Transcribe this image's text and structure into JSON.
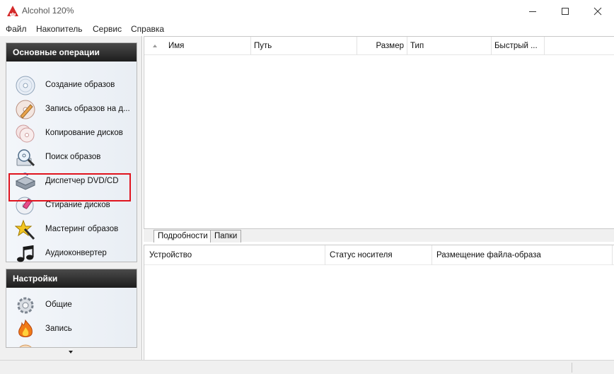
{
  "window": {
    "title": "Alcohol 120%",
    "minimize_icon": "minimize-icon",
    "maximize_icon": "maximize-icon",
    "close_icon": "close-icon"
  },
  "menu": [
    "Файл",
    "Накопитель",
    "Сервис",
    "Справка"
  ],
  "sidebar": {
    "main_group": {
      "title": "Основные операции",
      "items": [
        {
          "label": "Создание образов",
          "icon": "disc-create-icon"
        },
        {
          "label": "Запись образов на д...",
          "icon": "disc-burn-icon"
        },
        {
          "label": "Копирование дисков",
          "icon": "disc-copy-icon"
        },
        {
          "label": "Поиск образов",
          "icon": "image-search-icon"
        },
        {
          "label": "Диспетчер DVD/CD",
          "icon": "drive-manager-icon"
        },
        {
          "label": "Стирание дисков",
          "icon": "disc-erase-icon"
        },
        {
          "label": "Мастеринг образов",
          "icon": "mastering-star-icon"
        },
        {
          "label": "Аудиоконвертер",
          "icon": "audio-notes-icon"
        }
      ],
      "highlighted_item": "Поиск образов"
    },
    "settings_group": {
      "title": "Настройки",
      "items": [
        {
          "label": "Общие",
          "icon": "gear-icon"
        },
        {
          "label": "Запись",
          "icon": "flame-icon"
        }
      ]
    }
  },
  "image_list": {
    "columns": [
      "Имя",
      "Путь",
      "Размер",
      "Тип",
      "Быстрый ..."
    ],
    "rows": []
  },
  "tabs": [
    {
      "label": "Подробности",
      "active": true
    },
    {
      "label": "Папки",
      "active": false
    }
  ],
  "devices": {
    "columns": [
      "Устройство",
      "Статус носителя",
      "Размещение файла-образа"
    ],
    "rows": []
  },
  "colors": {
    "highlight": "#e0141e",
    "group_header": "#1d1d1d",
    "accent_red": "#d42a2a"
  }
}
